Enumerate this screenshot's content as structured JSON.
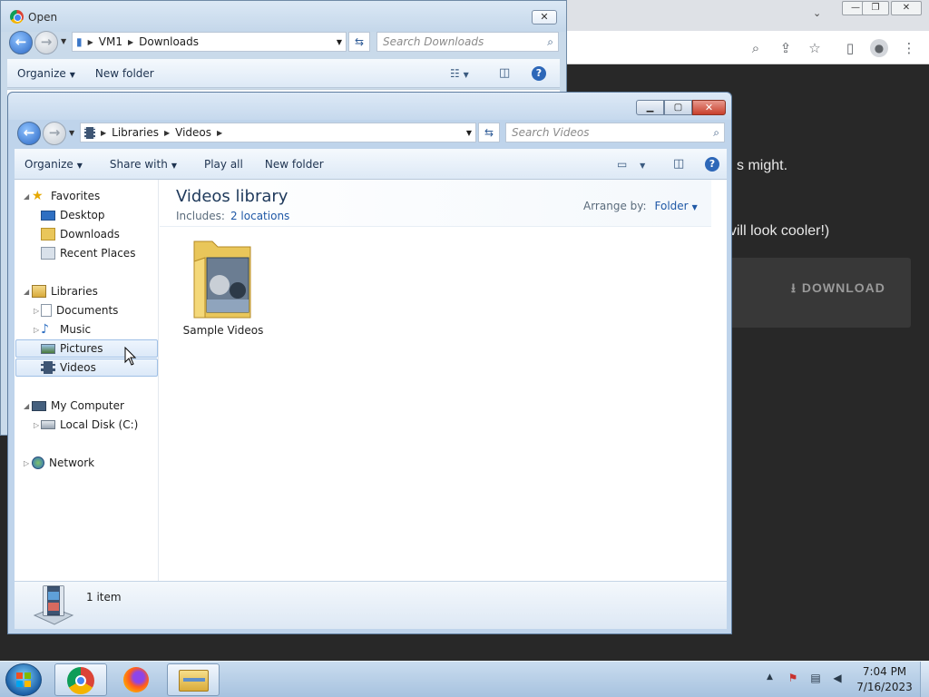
{
  "chrome": {
    "tools": [
      "search-icon",
      "share-icon",
      "star-icon",
      "sidepanel-icon",
      "account-icon",
      "menu-icon"
    ],
    "page_text_1": "s might.",
    "page_text_2": "vill look cooler!)",
    "download_label": "DOWNLOAD"
  },
  "open_dialog": {
    "title": "Open",
    "breadcrumb": [
      "VM1",
      "Downloads"
    ],
    "search_placeholder": "Search Downloads",
    "commands": {
      "organize": "Organize",
      "new_folder": "New folder"
    }
  },
  "explorer": {
    "breadcrumb": [
      "Libraries",
      "Videos"
    ],
    "search_placeholder": "Search Videos",
    "commands": {
      "organize": "Organize",
      "share_with": "Share with",
      "play_all": "Play all",
      "new_folder": "New folder"
    },
    "nav": {
      "favorites": "Favorites",
      "desktop": "Desktop",
      "downloads": "Downloads",
      "recent_places": "Recent Places",
      "libraries": "Libraries",
      "documents": "Documents",
      "music": "Music",
      "pictures": "Pictures",
      "videos": "Videos",
      "my_computer": "My Computer",
      "local_disk": "Local Disk (C:)",
      "network": "Network"
    },
    "library": {
      "title": "Videos library",
      "includes_label": "Includes:",
      "locations": "2 locations",
      "arrange_label": "Arrange by:",
      "arrange_value": "Folder"
    },
    "items": [
      {
        "name": "Sample Videos"
      }
    ],
    "status": "1 item"
  },
  "taskbar": {
    "time": "7:04 PM",
    "date": "7/16/2023"
  },
  "colors": {
    "accent_blue": "#1f58a6",
    "title_blue": "#1e395b",
    "close_red": "#c8402c"
  }
}
